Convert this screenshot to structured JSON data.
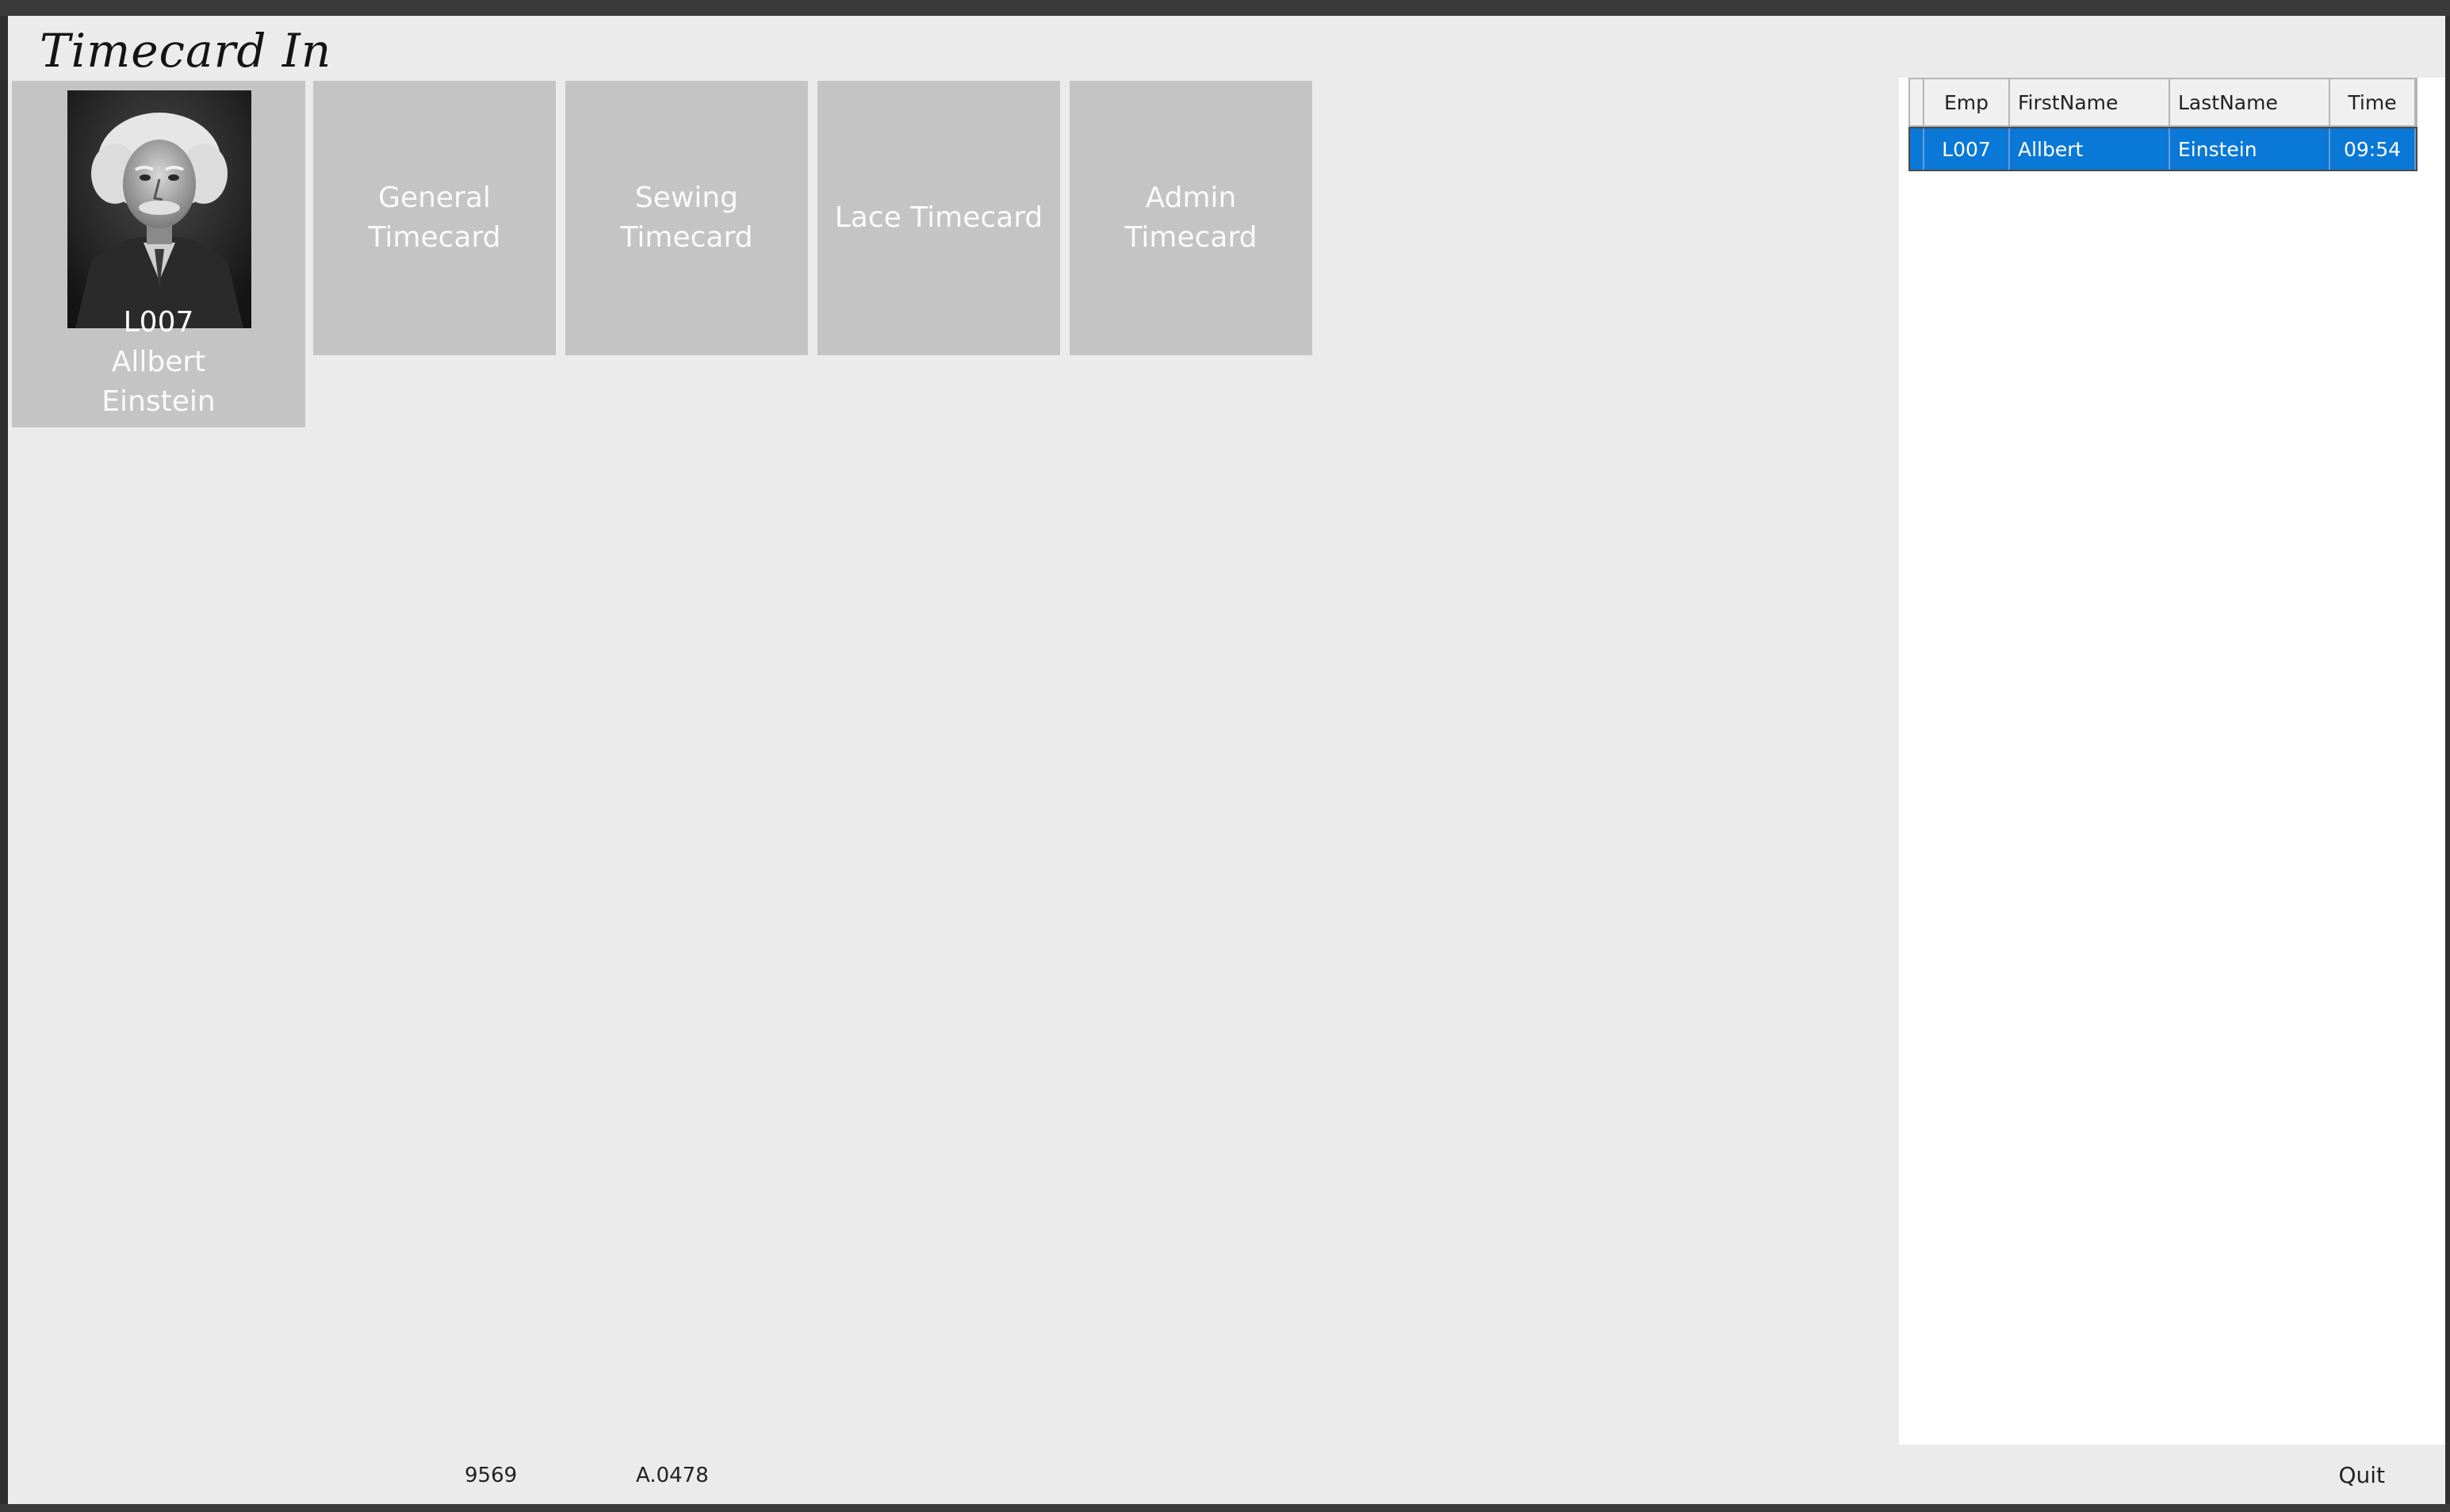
{
  "window": {
    "title": "Timecard In"
  },
  "employee_tile": {
    "id": "L007",
    "first_name": "Allbert",
    "last_name": "Einstein"
  },
  "timecards": [
    {
      "label": "General\nTimecard"
    },
    {
      "label": "Sewing\nTimecard"
    },
    {
      "label": "Lace Timecard"
    },
    {
      "label": "Admin\nTimecard"
    }
  ],
  "grid": {
    "columns": [
      "Emp",
      "FirstName",
      "LastName",
      "Time"
    ],
    "rows": [
      {
        "emp": "L007",
        "first": "Allbert",
        "last": "Einstein",
        "time": "09:54"
      }
    ]
  },
  "status": {
    "left": "9569",
    "mid": "A.0478",
    "quit_label": "Quit"
  },
  "colors": {
    "tile_bg": "#c4c4c4",
    "selection": "#0a78d7",
    "window_bg": "#ebebeb"
  }
}
